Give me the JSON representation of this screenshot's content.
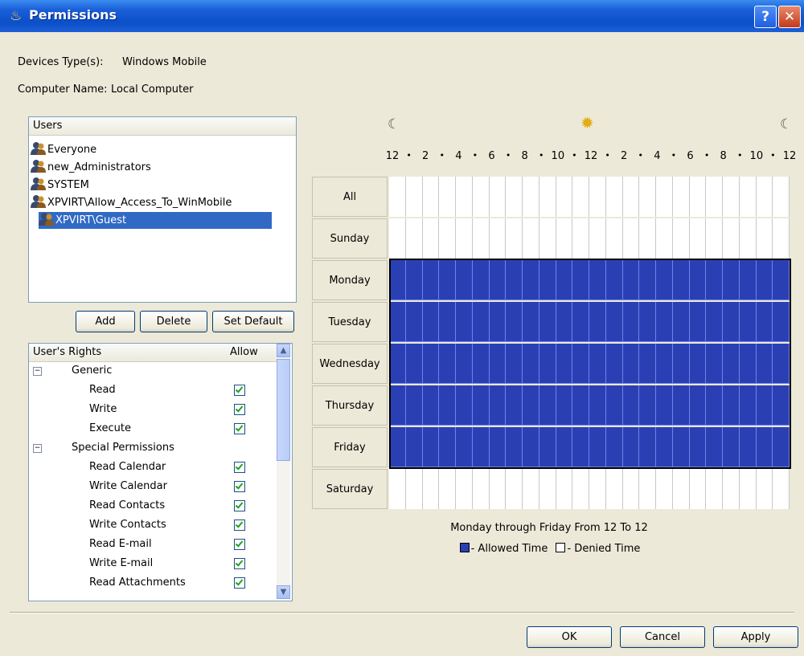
{
  "window": {
    "title": "Permissions",
    "help_label": "?",
    "close_label": "✕"
  },
  "info": {
    "device_type_label": "Devices Type(s):",
    "device_type_value": "Windows Mobile",
    "computer_name_label": "Computer Name:",
    "computer_name_value": "Local Computer"
  },
  "users": {
    "header": "Users",
    "items": [
      {
        "label": "Everyone",
        "selected": false
      },
      {
        "label": "new_Administrators",
        "selected": false
      },
      {
        "label": "SYSTEM",
        "selected": false
      },
      {
        "label": "XPVIRT\\Allow_Access_To_WinMobile",
        "selected": false
      },
      {
        "label": "XPVIRT\\Guest",
        "selected": true
      }
    ]
  },
  "buttons": {
    "add": "Add",
    "delete": "Delete",
    "set_default": "Set Default",
    "ok": "OK",
    "cancel": "Cancel",
    "apply": "Apply"
  },
  "rights": {
    "header_name": "User's Rights",
    "header_allow": "Allow",
    "groups": [
      {
        "label": "Generic",
        "expander": "⊟",
        "items": [
          {
            "label": "Read",
            "allowed": true
          },
          {
            "label": "Write",
            "allowed": true
          },
          {
            "label": "Execute",
            "allowed": true
          }
        ]
      },
      {
        "label": "Special Permissions",
        "expander": "⊟",
        "items": [
          {
            "label": "Read Calendar",
            "allowed": true
          },
          {
            "label": "Write Calendar",
            "allowed": true
          },
          {
            "label": "Read Contacts",
            "allowed": true
          },
          {
            "label": "Write Contacts",
            "allowed": true
          },
          {
            "label": "Read E-mail",
            "allowed": true
          },
          {
            "label": "Write E-mail",
            "allowed": true
          },
          {
            "label": "Read Attachments",
            "allowed": true
          }
        ]
      }
    ],
    "scroll_up": "▲",
    "scroll_down": "▼"
  },
  "schedule": {
    "hour_ticks": [
      "12",
      "•",
      "2",
      "•",
      "4",
      "•",
      "6",
      "•",
      "8",
      "•",
      "10",
      "•",
      "12",
      "•",
      "2",
      "•",
      "4",
      "•",
      "6",
      "•",
      "8",
      "•",
      "10",
      "•",
      "12"
    ],
    "moon_icon": "☾",
    "sun_icon": "✹",
    "slots_per_day": 24,
    "days": [
      {
        "label": "All",
        "allowed_slots": []
      },
      {
        "label": "Sunday",
        "allowed_slots": []
      },
      {
        "label": "Monday",
        "allowed_slots": [
          0,
          1,
          2,
          3,
          4,
          5,
          6,
          7,
          8,
          9,
          10,
          11,
          12,
          13,
          14,
          15,
          16,
          17,
          18,
          19,
          20,
          21,
          22,
          23
        ]
      },
      {
        "label": "Tuesday",
        "allowed_slots": [
          0,
          1,
          2,
          3,
          4,
          5,
          6,
          7,
          8,
          9,
          10,
          11,
          12,
          13,
          14,
          15,
          16,
          17,
          18,
          19,
          20,
          21,
          22,
          23
        ]
      },
      {
        "label": "Wednesday",
        "allowed_slots": [
          0,
          1,
          2,
          3,
          4,
          5,
          6,
          7,
          8,
          9,
          10,
          11,
          12,
          13,
          14,
          15,
          16,
          17,
          18,
          19,
          20,
          21,
          22,
          23
        ]
      },
      {
        "label": "Thursday",
        "allowed_slots": [
          0,
          1,
          2,
          3,
          4,
          5,
          6,
          7,
          8,
          9,
          10,
          11,
          12,
          13,
          14,
          15,
          16,
          17,
          18,
          19,
          20,
          21,
          22,
          23
        ]
      },
      {
        "label": "Friday",
        "allowed_slots": [
          0,
          1,
          2,
          3,
          4,
          5,
          6,
          7,
          8,
          9,
          10,
          11,
          12,
          13,
          14,
          15,
          16,
          17,
          18,
          19,
          20,
          21,
          22,
          23
        ]
      },
      {
        "label": "Saturday",
        "allowed_slots": []
      }
    ],
    "summary": "Monday through Friday From 12 To 12",
    "legend_allowed": "- Allowed Time",
    "legend_denied": "- Denied Time",
    "colors": {
      "allowed": "#2b3fb5",
      "denied": "#ffffff",
      "allowed_grid": "#6f84e6",
      "denied_grid": "#c8c8c8"
    }
  }
}
